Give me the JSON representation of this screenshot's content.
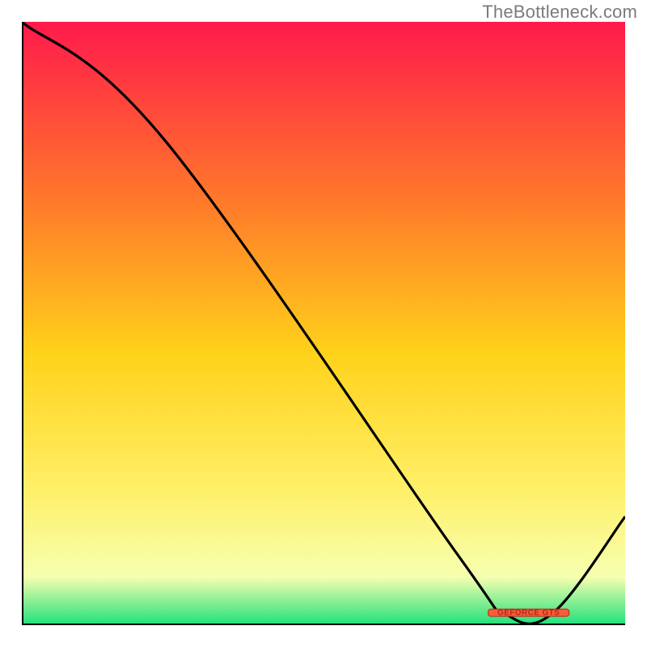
{
  "attribution": "TheBottleneck.com",
  "marker_label": "GEFORCE GTS",
  "colors": {
    "grad_top": "#ff1a4b",
    "grad_mid1": "#ff7a2a",
    "grad_mid2": "#ffd21a",
    "grad_mid3": "#fff06a",
    "grad_mid4": "#f6ffb0",
    "grad_bot": "#1fe07a",
    "axis": "#000000",
    "curve": "#000000",
    "marker_fill": "#ff5b3a",
    "marker_stroke": "#b02a16"
  },
  "chart_data": {
    "type": "line",
    "title": "",
    "xlabel": "",
    "ylabel": "",
    "xlim": [
      0,
      100
    ],
    "ylim": [
      0,
      100
    ],
    "x": [
      0,
      24,
      72,
      80,
      88,
      100
    ],
    "values": [
      100,
      80,
      12,
      2,
      2,
      18
    ],
    "marker": {
      "x": 84,
      "y": 2,
      "label": "GEFORCE GTS"
    }
  }
}
